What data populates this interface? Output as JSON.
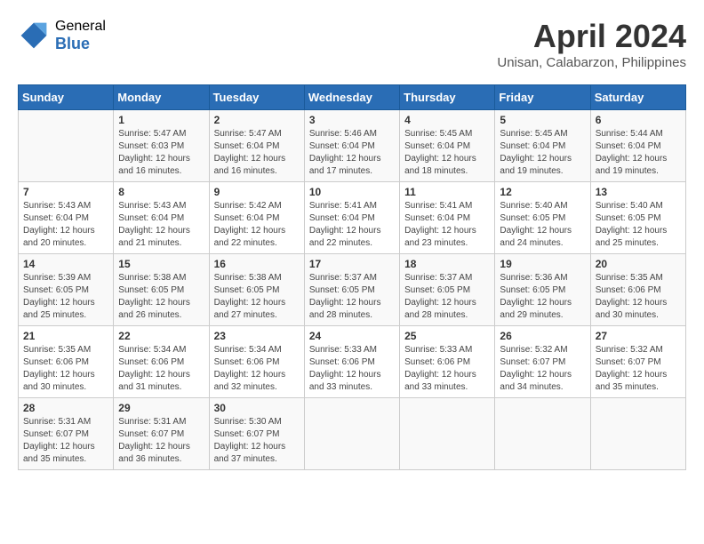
{
  "header": {
    "logo_general": "General",
    "logo_blue": "Blue",
    "month_title": "April 2024",
    "subtitle": "Unisan, Calabarzon, Philippines"
  },
  "weekdays": [
    "Sunday",
    "Monday",
    "Tuesday",
    "Wednesday",
    "Thursday",
    "Friday",
    "Saturday"
  ],
  "weeks": [
    [
      {
        "day": "",
        "content": ""
      },
      {
        "day": "1",
        "content": "Sunrise: 5:47 AM\nSunset: 6:03 PM\nDaylight: 12 hours\nand 16 minutes."
      },
      {
        "day": "2",
        "content": "Sunrise: 5:47 AM\nSunset: 6:04 PM\nDaylight: 12 hours\nand 16 minutes."
      },
      {
        "day": "3",
        "content": "Sunrise: 5:46 AM\nSunset: 6:04 PM\nDaylight: 12 hours\nand 17 minutes."
      },
      {
        "day": "4",
        "content": "Sunrise: 5:45 AM\nSunset: 6:04 PM\nDaylight: 12 hours\nand 18 minutes."
      },
      {
        "day": "5",
        "content": "Sunrise: 5:45 AM\nSunset: 6:04 PM\nDaylight: 12 hours\nand 19 minutes."
      },
      {
        "day": "6",
        "content": "Sunrise: 5:44 AM\nSunset: 6:04 PM\nDaylight: 12 hours\nand 19 minutes."
      }
    ],
    [
      {
        "day": "7",
        "content": "Sunrise: 5:43 AM\nSunset: 6:04 PM\nDaylight: 12 hours\nand 20 minutes."
      },
      {
        "day": "8",
        "content": "Sunrise: 5:43 AM\nSunset: 6:04 PM\nDaylight: 12 hours\nand 21 minutes."
      },
      {
        "day": "9",
        "content": "Sunrise: 5:42 AM\nSunset: 6:04 PM\nDaylight: 12 hours\nand 22 minutes."
      },
      {
        "day": "10",
        "content": "Sunrise: 5:41 AM\nSunset: 6:04 PM\nDaylight: 12 hours\nand 22 minutes."
      },
      {
        "day": "11",
        "content": "Sunrise: 5:41 AM\nSunset: 6:04 PM\nDaylight: 12 hours\nand 23 minutes."
      },
      {
        "day": "12",
        "content": "Sunrise: 5:40 AM\nSunset: 6:05 PM\nDaylight: 12 hours\nand 24 minutes."
      },
      {
        "day": "13",
        "content": "Sunrise: 5:40 AM\nSunset: 6:05 PM\nDaylight: 12 hours\nand 25 minutes."
      }
    ],
    [
      {
        "day": "14",
        "content": "Sunrise: 5:39 AM\nSunset: 6:05 PM\nDaylight: 12 hours\nand 25 minutes."
      },
      {
        "day": "15",
        "content": "Sunrise: 5:38 AM\nSunset: 6:05 PM\nDaylight: 12 hours\nand 26 minutes."
      },
      {
        "day": "16",
        "content": "Sunrise: 5:38 AM\nSunset: 6:05 PM\nDaylight: 12 hours\nand 27 minutes."
      },
      {
        "day": "17",
        "content": "Sunrise: 5:37 AM\nSunset: 6:05 PM\nDaylight: 12 hours\nand 28 minutes."
      },
      {
        "day": "18",
        "content": "Sunrise: 5:37 AM\nSunset: 6:05 PM\nDaylight: 12 hours\nand 28 minutes."
      },
      {
        "day": "19",
        "content": "Sunrise: 5:36 AM\nSunset: 6:05 PM\nDaylight: 12 hours\nand 29 minutes."
      },
      {
        "day": "20",
        "content": "Sunrise: 5:35 AM\nSunset: 6:06 PM\nDaylight: 12 hours\nand 30 minutes."
      }
    ],
    [
      {
        "day": "21",
        "content": "Sunrise: 5:35 AM\nSunset: 6:06 PM\nDaylight: 12 hours\nand 30 minutes."
      },
      {
        "day": "22",
        "content": "Sunrise: 5:34 AM\nSunset: 6:06 PM\nDaylight: 12 hours\nand 31 minutes."
      },
      {
        "day": "23",
        "content": "Sunrise: 5:34 AM\nSunset: 6:06 PM\nDaylight: 12 hours\nand 32 minutes."
      },
      {
        "day": "24",
        "content": "Sunrise: 5:33 AM\nSunset: 6:06 PM\nDaylight: 12 hours\nand 33 minutes."
      },
      {
        "day": "25",
        "content": "Sunrise: 5:33 AM\nSunset: 6:06 PM\nDaylight: 12 hours\nand 33 minutes."
      },
      {
        "day": "26",
        "content": "Sunrise: 5:32 AM\nSunset: 6:07 PM\nDaylight: 12 hours\nand 34 minutes."
      },
      {
        "day": "27",
        "content": "Sunrise: 5:32 AM\nSunset: 6:07 PM\nDaylight: 12 hours\nand 35 minutes."
      }
    ],
    [
      {
        "day": "28",
        "content": "Sunrise: 5:31 AM\nSunset: 6:07 PM\nDaylight: 12 hours\nand 35 minutes."
      },
      {
        "day": "29",
        "content": "Sunrise: 5:31 AM\nSunset: 6:07 PM\nDaylight: 12 hours\nand 36 minutes."
      },
      {
        "day": "30",
        "content": "Sunrise: 5:30 AM\nSunset: 6:07 PM\nDaylight: 12 hours\nand 37 minutes."
      },
      {
        "day": "",
        "content": ""
      },
      {
        "day": "",
        "content": ""
      },
      {
        "day": "",
        "content": ""
      },
      {
        "day": "",
        "content": ""
      }
    ]
  ]
}
